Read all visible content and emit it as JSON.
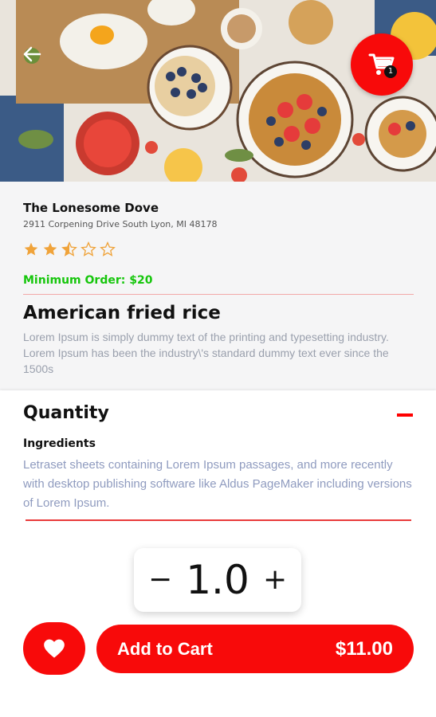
{
  "restaurant": {
    "name": "The Lonesome Dove",
    "address": "2911 Corpening Drive South Lyon, MI 48178",
    "rating": 2.5,
    "rating_max": 5,
    "min_order": "Minimum Order: $20"
  },
  "cart": {
    "count": "1"
  },
  "dish": {
    "title": "American fried rice",
    "description": "Lorem Ipsum is simply dummy text of the printing and typesetting industry. Lorem Ipsum has been the industry\\'s standard dummy text ever since the 1500s"
  },
  "quantity": {
    "label": "Quantity",
    "ingredients_label": "Ingredients",
    "ingredients_text": "Letraset sheets containing Lorem Ipsum passages, and more recently with desktop publishing software like Aldus PageMaker including versions of Lorem Ipsum.",
    "minus": "−",
    "plus": "+",
    "value": "1.0"
  },
  "actions": {
    "add_to_cart": "Add to Cart",
    "price": "$11.00"
  },
  "colors": {
    "accent": "#f80a0a",
    "min_order": "#16c60c",
    "star": "#f0a33a"
  }
}
